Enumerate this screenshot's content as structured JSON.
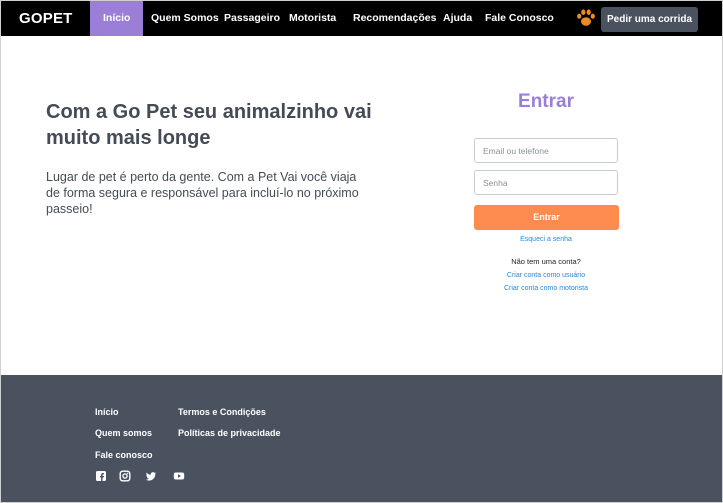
{
  "navbar": {
    "brand": "GOPET",
    "items": [
      {
        "label": "Início"
      },
      {
        "label": "Quem Somos"
      },
      {
        "label": "Passageiro"
      },
      {
        "label": "Motorista"
      },
      {
        "label": "Recomendações"
      },
      {
        "label": "Ajuda"
      },
      {
        "label": "Fale Conosco"
      }
    ],
    "paw_icon": "paw-icon",
    "cta_label": "Pedir uma corrida",
    "colors": {
      "background": "#000000",
      "active": "#9b7fd6",
      "cta": "#4a5260"
    }
  },
  "hero": {
    "title": "Com a Go Pet seu animalzinho vai muito mais longe",
    "text": "Lugar de pet é perto da gente. Com a Pet Vai você viaja de forma segura e responsável para incluí-lo no próximo passeio!"
  },
  "login": {
    "title": "Entrar",
    "email_placeholder": "Email ou telefone",
    "email_value": "",
    "password_placeholder": "Senha",
    "password_value": "",
    "submit_label": "Entrar",
    "forgot_label": "Esqueci a senha",
    "no_account_label": "Não tem uma conta?",
    "signup_user_label": "Criar conta como usuário",
    "signup_driver_label": "Criar conta como motorista",
    "colors": {
      "title": "#9b7fd6",
      "button": "#fd8c4e",
      "link": "#2b88d8"
    }
  },
  "footer": {
    "col1": [
      {
        "label": "Início"
      },
      {
        "label": "Quem somos"
      },
      {
        "label": "Fale conosco"
      }
    ],
    "col2": [
      {
        "label": "Termos e Condições"
      },
      {
        "label": "Políticas de privacidade"
      }
    ],
    "social": [
      "facebook-icon",
      "instagram-icon",
      "twitter-icon",
      "youtube-icon"
    ],
    "colors": {
      "background": "#4a5260"
    }
  }
}
